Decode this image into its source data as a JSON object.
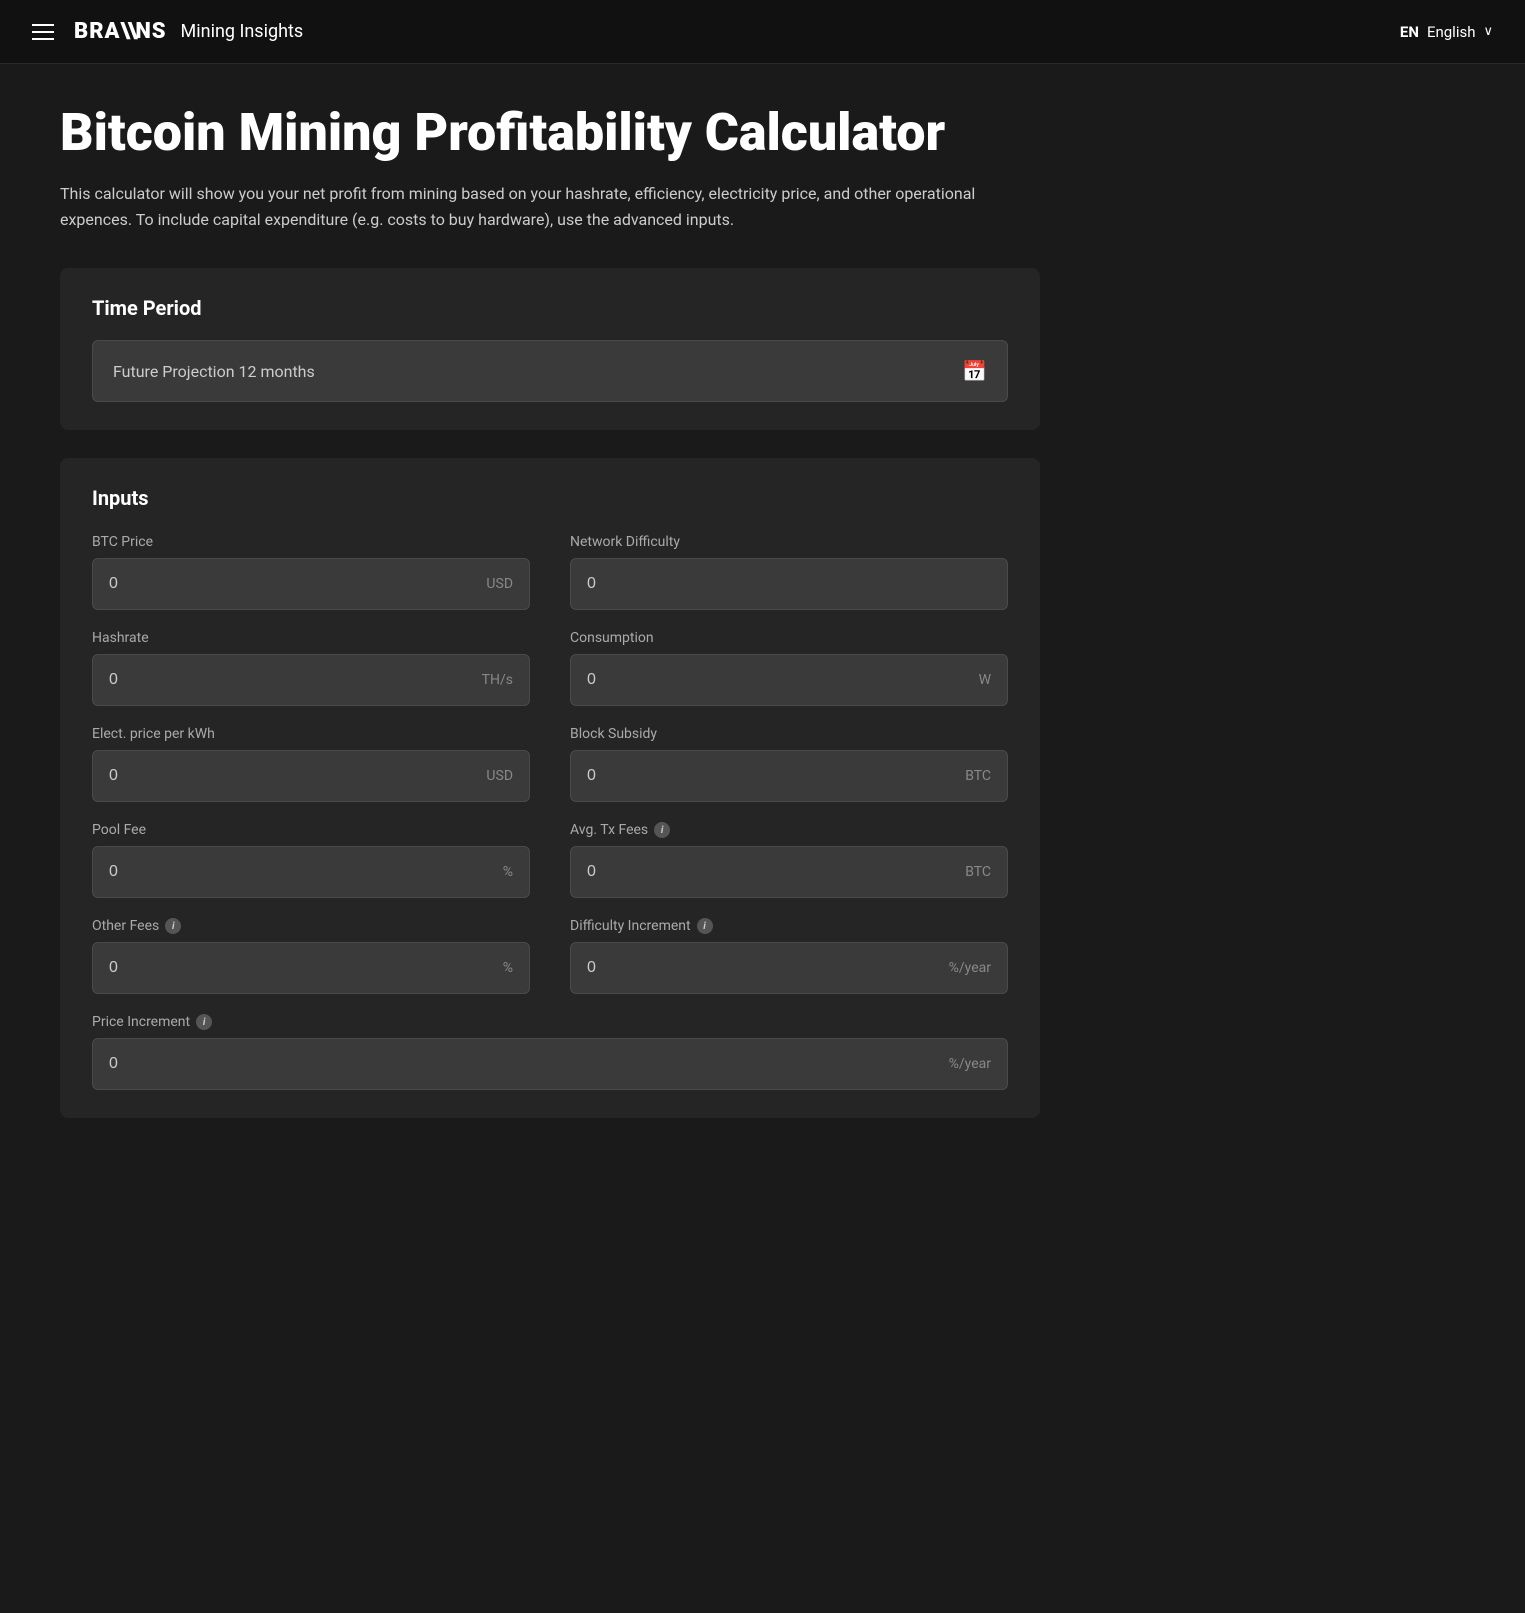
{
  "header": {
    "menu_label": "menu",
    "logo_brand": "BRA\\\\NS",
    "logo_subtitle": "Mining Insights",
    "lang_code": "EN",
    "lang_name": "English",
    "lang_chevron": "∨"
  },
  "page": {
    "title": "Bitcoin Mining Profitability Calculator",
    "description": "This calculator will show you your net profit from mining based on your hashrate, efficiency, electricity price, and other operational expences. To include capital expenditure (e.g. costs to buy hardware), use the advanced inputs."
  },
  "time_period": {
    "section_title": "Time Period",
    "selected_value": "Future Projection 12 months"
  },
  "inputs": {
    "section_title": "Inputs",
    "fields": [
      {
        "id": "btc-price",
        "label": "BTC Price",
        "value": "0",
        "unit": "USD",
        "has_info": false,
        "col": "left"
      },
      {
        "id": "network-difficulty",
        "label": "Network Difficulty",
        "value": "0",
        "unit": "",
        "has_info": false,
        "col": "right"
      },
      {
        "id": "hashrate",
        "label": "Hashrate",
        "value": "0",
        "unit": "TH/s",
        "has_info": false,
        "col": "left"
      },
      {
        "id": "consumption",
        "label": "Consumption",
        "value": "0",
        "unit": "W",
        "has_info": false,
        "col": "right"
      },
      {
        "id": "elect-price",
        "label": "Elect. price per kWh",
        "value": "0",
        "unit": "USD",
        "has_info": false,
        "col": "left"
      },
      {
        "id": "block-subsidy",
        "label": "Block Subsidy",
        "value": "0",
        "unit": "BTC",
        "has_info": false,
        "col": "right"
      },
      {
        "id": "pool-fee",
        "label": "Pool Fee",
        "value": "0",
        "unit": "%",
        "has_info": false,
        "col": "left"
      },
      {
        "id": "avg-tx-fees",
        "label": "Avg. Tx Fees",
        "value": "0",
        "unit": "BTC",
        "has_info": true,
        "col": "right"
      },
      {
        "id": "other-fees",
        "label": "Other Fees",
        "value": "0",
        "unit": "%",
        "has_info": true,
        "col": "left"
      },
      {
        "id": "difficulty-increment",
        "label": "Difficulty Increment",
        "value": "0",
        "unit": "%/year",
        "has_info": true,
        "col": "right"
      },
      {
        "id": "price-increment",
        "label": "Price Increment",
        "value": "0",
        "unit": "%/year",
        "has_info": true,
        "col": "full"
      }
    ]
  }
}
